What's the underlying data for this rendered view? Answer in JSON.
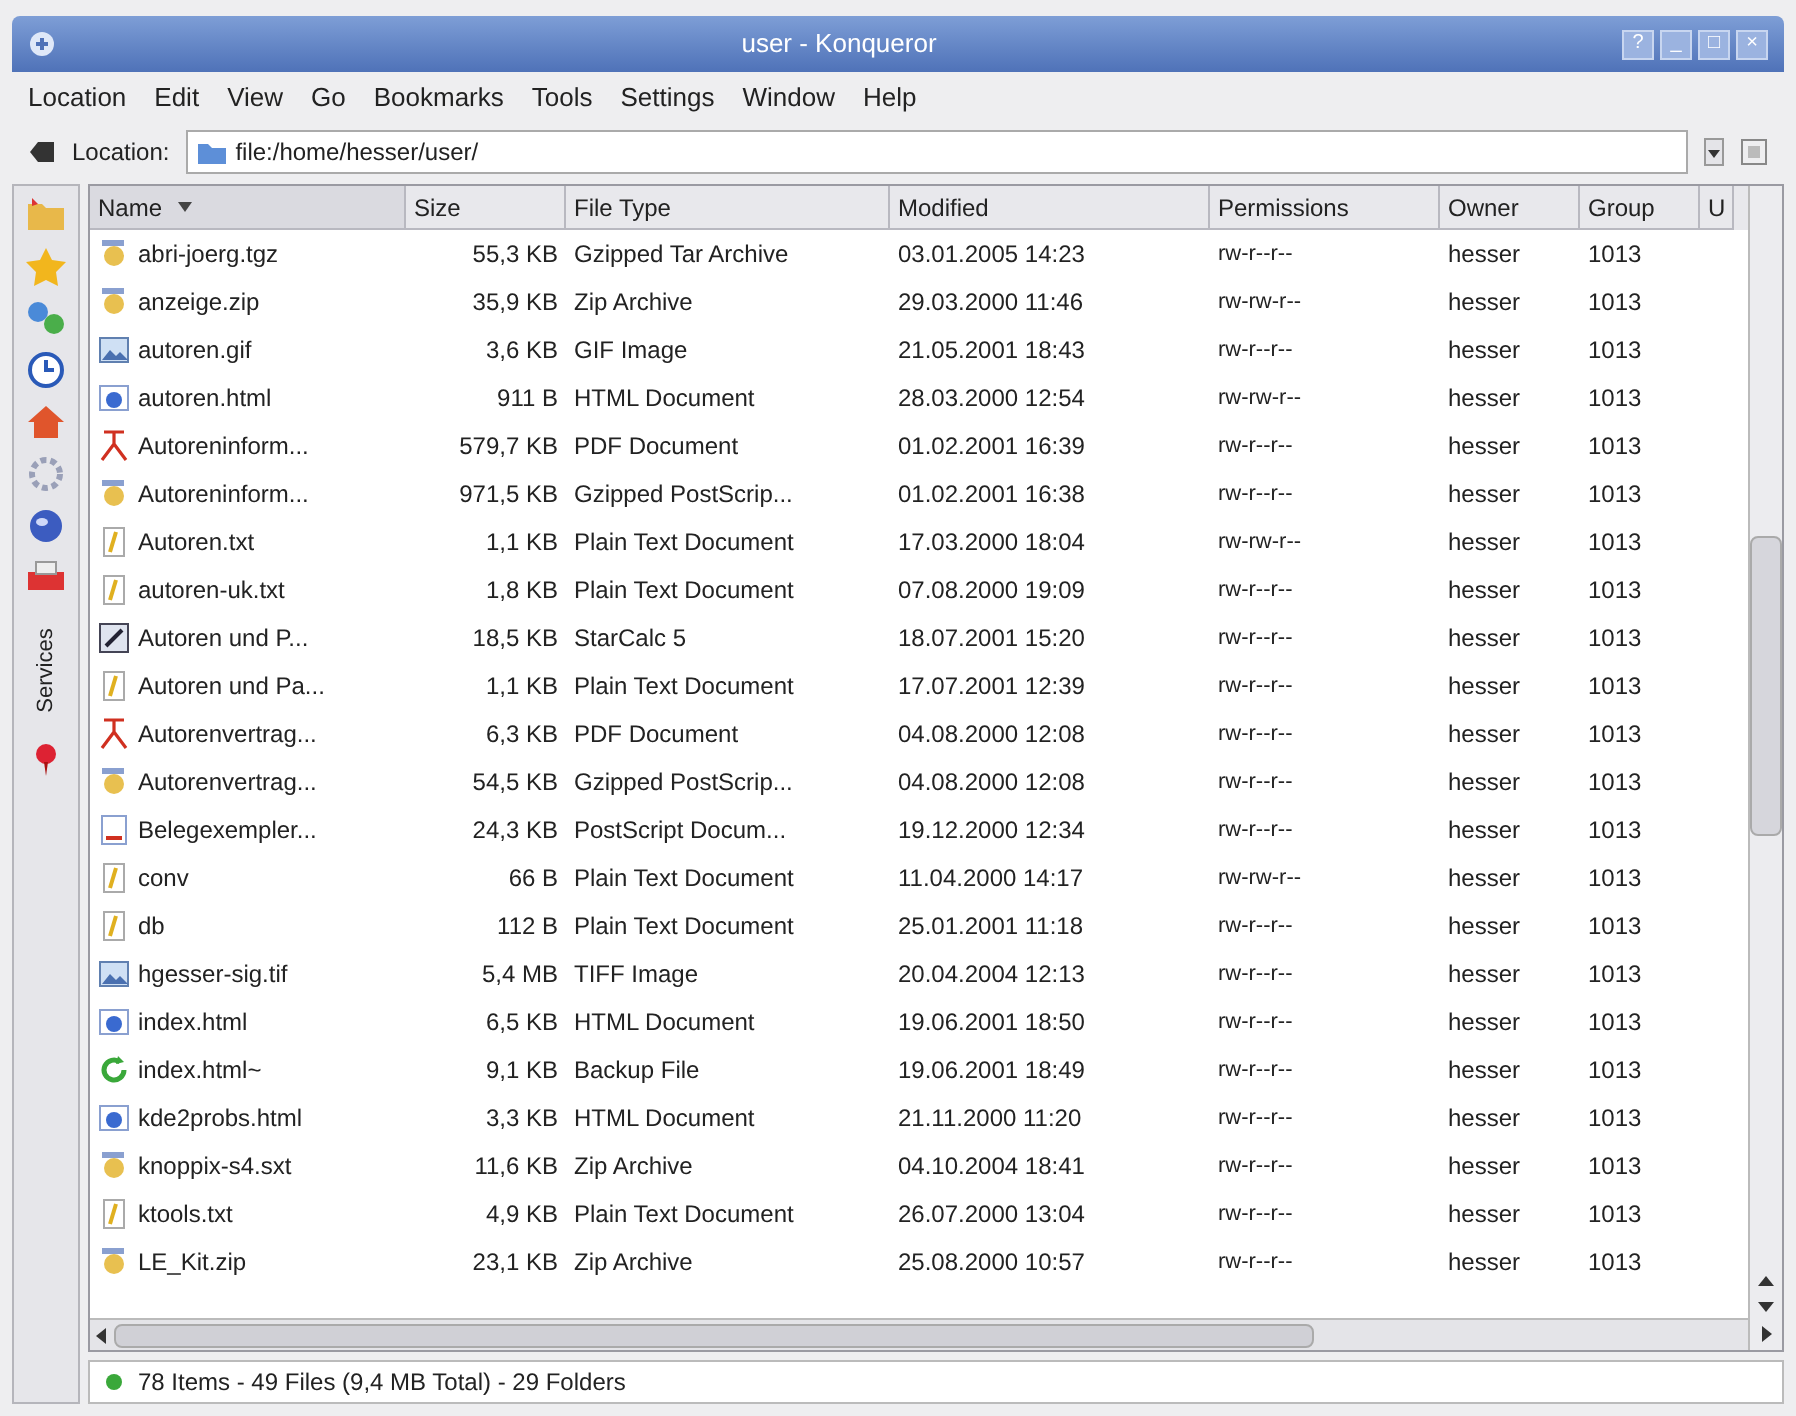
{
  "window": {
    "title": "user - Konqueror",
    "buttons": [
      "?",
      "_",
      "□",
      "×"
    ]
  },
  "menu": [
    "Location",
    "Edit",
    "View",
    "Go",
    "Bookmarks",
    "Tools",
    "Settings",
    "Window",
    "Help"
  ],
  "location_bar": {
    "label": "Location:",
    "value": "file:/home/hesser/user/"
  },
  "sidebar": {
    "tab": "Services"
  },
  "table": {
    "columns": [
      {
        "label": "Name",
        "sorted": true
      },
      {
        "label": "Size",
        "sorted": false
      },
      {
        "label": "File Type",
        "sorted": false
      },
      {
        "label": "Modified",
        "sorted": false
      },
      {
        "label": "Permissions",
        "sorted": false
      },
      {
        "label": "Owner",
        "sorted": false
      },
      {
        "label": "Group",
        "sorted": false
      },
      {
        "label": "U",
        "sorted": false
      }
    ],
    "rows": [
      {
        "kind": "archive",
        "name": "abri-joerg.tgz",
        "size": "55,3 KB",
        "type": "Gzipped Tar Archive",
        "modified": "03.01.2005 14:23",
        "permissions": "rw-r--r--",
        "owner": "hesser",
        "group": "1013"
      },
      {
        "kind": "archive",
        "name": "anzeige.zip",
        "size": "35,9 KB",
        "type": "Zip Archive",
        "modified": "29.03.2000 11:46",
        "permissions": "rw-rw-r--",
        "owner": "hesser",
        "group": "1013"
      },
      {
        "kind": "image",
        "name": "autoren.gif",
        "size": "3,6 KB",
        "type": "GIF Image",
        "modified": "21.05.2001 18:43",
        "permissions": "rw-r--r--",
        "owner": "hesser",
        "group": "1013"
      },
      {
        "kind": "html",
        "name": "autoren.html",
        "size": "911 B",
        "type": "HTML Document",
        "modified": "28.03.2000 12:54",
        "permissions": "rw-rw-r--",
        "owner": "hesser",
        "group": "1013"
      },
      {
        "kind": "pdf",
        "name": "Autoreninform...",
        "size": "579,7 KB",
        "type": "PDF Document",
        "modified": "01.02.2001 16:39",
        "permissions": "rw-r--r--",
        "owner": "hesser",
        "group": "1013"
      },
      {
        "kind": "archive",
        "name": "Autoreninform...",
        "size": "971,5 KB",
        "type": "Gzipped PostScrip...",
        "modified": "01.02.2001 16:38",
        "permissions": "rw-r--r--",
        "owner": "hesser",
        "group": "1013"
      },
      {
        "kind": "text",
        "name": "Autoren.txt",
        "size": "1,1 KB",
        "type": "Plain Text Document",
        "modified": "17.03.2000 18:04",
        "permissions": "rw-rw-r--",
        "owner": "hesser",
        "group": "1013"
      },
      {
        "kind": "text",
        "name": "autoren-uk.txt",
        "size": "1,8 KB",
        "type": "Plain Text Document",
        "modified": "07.08.2000 19:09",
        "permissions": "rw-r--r--",
        "owner": "hesser",
        "group": "1013"
      },
      {
        "kind": "spreadsheet",
        "name": "Autoren und P...",
        "size": "18,5 KB",
        "type": "StarCalc 5",
        "modified": "18.07.2001 15:20",
        "permissions": "rw-r--r--",
        "owner": "hesser",
        "group": "1013"
      },
      {
        "kind": "text",
        "name": "Autoren und Pa...",
        "size": "1,1 KB",
        "type": "Plain Text Document",
        "modified": "17.07.2001 12:39",
        "permissions": "rw-r--r--",
        "owner": "hesser",
        "group": "1013"
      },
      {
        "kind": "pdf",
        "name": "Autorenvertrag...",
        "size": "6,3 KB",
        "type": "PDF Document",
        "modified": "04.08.2000 12:08",
        "permissions": "rw-r--r--",
        "owner": "hesser",
        "group": "1013"
      },
      {
        "kind": "archive",
        "name": "Autorenvertrag...",
        "size": "54,5 KB",
        "type": "Gzipped PostScrip...",
        "modified": "04.08.2000 12:08",
        "permissions": "rw-r--r--",
        "owner": "hesser",
        "group": "1013"
      },
      {
        "kind": "postscript",
        "name": "Belegexempler...",
        "size": "24,3 KB",
        "type": "PostScript Docum...",
        "modified": "19.12.2000 12:34",
        "permissions": "rw-r--r--",
        "owner": "hesser",
        "group": "1013"
      },
      {
        "kind": "text",
        "name": "conv",
        "size": "66 B",
        "type": "Plain Text Document",
        "modified": "11.04.2000 14:17",
        "permissions": "rw-rw-r--",
        "owner": "hesser",
        "group": "1013"
      },
      {
        "kind": "text",
        "name": "db",
        "size": "112 B",
        "type": "Plain Text Document",
        "modified": "25.01.2001 11:18",
        "permissions": "rw-r--r--",
        "owner": "hesser",
        "group": "1013"
      },
      {
        "kind": "image",
        "name": "hgesser-sig.tif",
        "size": "5,4 MB",
        "type": "TIFF Image",
        "modified": "20.04.2004 12:13",
        "permissions": "rw-r--r--",
        "owner": "hesser",
        "group": "1013"
      },
      {
        "kind": "html",
        "name": "index.html",
        "size": "6,5 KB",
        "type": "HTML Document",
        "modified": "19.06.2001 18:50",
        "permissions": "rw-r--r--",
        "owner": "hesser",
        "group": "1013"
      },
      {
        "kind": "backup",
        "name": "index.html~",
        "size": "9,1 KB",
        "type": "Backup File",
        "modified": "19.06.2001 18:49",
        "permissions": "rw-r--r--",
        "owner": "hesser",
        "group": "1013"
      },
      {
        "kind": "html",
        "name": "kde2probs.html",
        "size": "3,3 KB",
        "type": "HTML Document",
        "modified": "21.11.2000 11:20",
        "permissions": "rw-r--r--",
        "owner": "hesser",
        "group": "1013"
      },
      {
        "kind": "archive",
        "name": "knoppix-s4.sxt",
        "size": "11,6 KB",
        "type": "Zip Archive",
        "modified": "04.10.2004 18:41",
        "permissions": "rw-r--r--",
        "owner": "hesser",
        "group": "1013"
      },
      {
        "kind": "text",
        "name": "ktools.txt",
        "size": "4,9 KB",
        "type": "Plain Text Document",
        "modified": "26.07.2000 13:04",
        "permissions": "rw-r--r--",
        "owner": "hesser",
        "group": "1013"
      },
      {
        "kind": "archive",
        "name": "LE_Kit.zip",
        "size": "23,1 KB",
        "type": "Zip Archive",
        "modified": "25.08.2000 10:57",
        "permissions": "rw-r--r--",
        "owner": "hesser",
        "group": "1013"
      }
    ]
  },
  "status_bar": "78 Items - 49 Files (9,4 MB Total) - 29 Folders"
}
